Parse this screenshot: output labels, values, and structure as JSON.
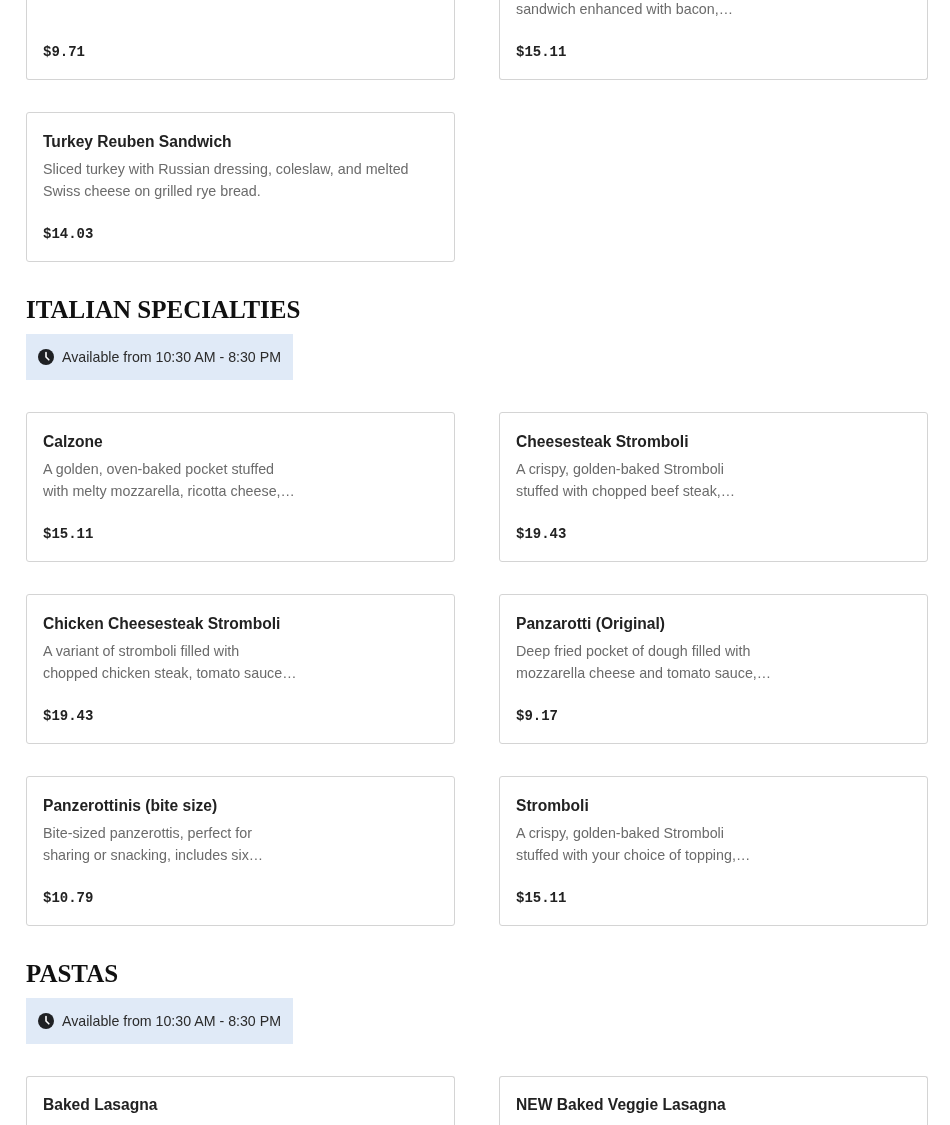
{
  "sections": [
    {
      "items": [
        {
          "price": "$9.71"
        },
        {
          "description_lines": [
            "sandwich enhanced with bacon,…"
          ],
          "price": "$15.11"
        },
        {
          "name": "Turkey Reuben Sandwich",
          "description_lines": [
            "Sliced turkey with Russian dressing, coleslaw, and melted",
            "Swiss cheese on grilled rye bread."
          ],
          "price": "$14.03"
        }
      ]
    },
    {
      "title": "ITALIAN SPECIALTIES",
      "availability": "Available from 10:30 AM - 8:30 PM",
      "items": [
        {
          "name": "Calzone",
          "description_lines": [
            "A golden, oven-baked pocket stuffed",
            "with melty mozzarella, ricotta cheese,…"
          ],
          "price": "$15.11"
        },
        {
          "name": "Cheesesteak Stromboli",
          "description_lines": [
            "A crispy, golden-baked Stromboli",
            "stuffed with chopped beef steak,…"
          ],
          "price": "$19.43"
        },
        {
          "name": "Chicken Cheesesteak Stromboli",
          "description_lines": [
            "A variant of stromboli filled with",
            "chopped chicken steak, tomato sauce…"
          ],
          "price": "$19.43"
        },
        {
          "name": "Panzarotti (Original)",
          "description_lines": [
            "Deep fried pocket of dough filled with",
            "mozzarella cheese and tomato sauce,…"
          ],
          "price": "$9.17"
        },
        {
          "name": "Panzerottinis (bite size)",
          "description_lines": [
            "Bite-sized panzerottis, perfect for",
            "sharing or snacking, includes six…"
          ],
          "price": "$10.79"
        },
        {
          "name": "Stromboli",
          "description_lines": [
            "A crispy, golden-baked Stromboli",
            "stuffed with your choice of topping,…"
          ],
          "price": "$15.11"
        }
      ]
    },
    {
      "title": "PASTAS",
      "availability": "Available from 10:30 AM - 8:30 PM",
      "items": [
        {
          "name": "Baked Lasagna"
        },
        {
          "name": "NEW Baked Veggie Lasagna"
        }
      ]
    }
  ]
}
